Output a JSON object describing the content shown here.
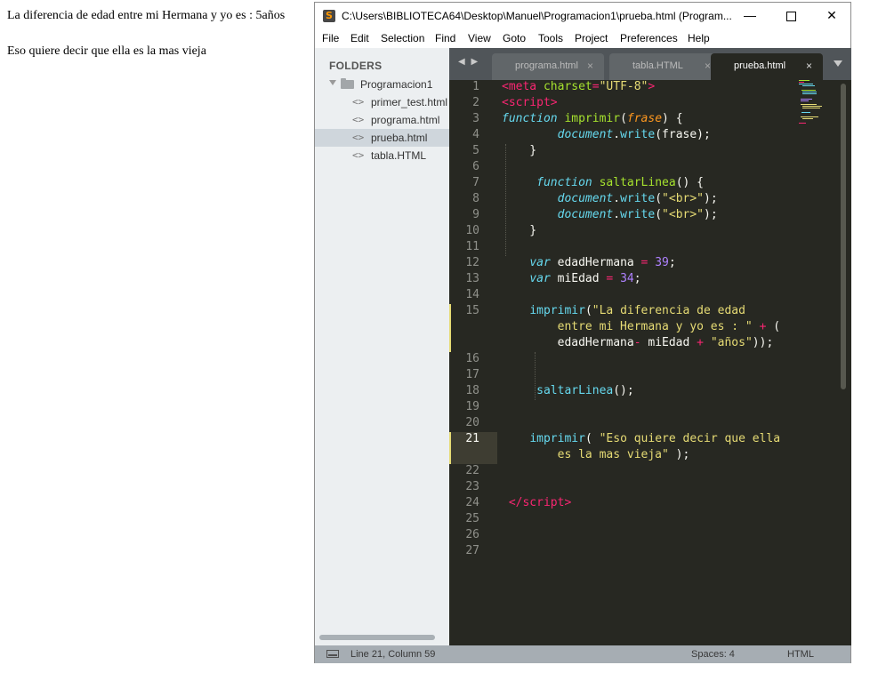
{
  "browser": {
    "line1": "La diferencia de edad entre mi Hermana y yo es : 5años",
    "line2": "Eso quiere decir que ella es la mas vieja"
  },
  "window": {
    "title": "C:\\Users\\BIBLIOTECA64\\Desktop\\Manuel\\Programacion1\\prueba.html (Program...",
    "app_icon": "S",
    "icons": [
      "sublime-text-icon",
      "minimize-icon",
      "maximize-icon",
      "close-icon"
    ]
  },
  "menu": [
    "File",
    "Edit",
    "Selection",
    "Find",
    "View",
    "Goto",
    "Tools",
    "Project",
    "Preferences",
    "Help"
  ],
  "sidebar": {
    "title": "FOLDERS",
    "folder": "Programacion1",
    "files": [
      "primer_test.html",
      "programa.html",
      "prueba.html",
      "tabla.HTML"
    ],
    "active_file": "prueba.html",
    "file_icon": "<>"
  },
  "tabs": {
    "nav": "◀ ▶",
    "items": [
      {
        "label": "programa.html",
        "close": "×"
      },
      {
        "label": "tabla.HTML",
        "close": "×"
      },
      {
        "label": "prueba.html",
        "close": "×"
      }
    ],
    "active": "prueba.html"
  },
  "editor": {
    "line_numbers": [
      "1",
      "2",
      "3",
      "4",
      "5",
      "6",
      "7",
      "8",
      "9",
      "10",
      "11",
      "12",
      "13",
      "14",
      "15",
      "16",
      "17",
      "18",
      "19",
      "20",
      "21",
      "22",
      "23",
      "24",
      "25",
      "26",
      "27"
    ],
    "current_line": "21",
    "theme_colors": {
      "background": "#272822",
      "tag": "#f92672",
      "string": "#e6db74",
      "keyword": "#66d9ef",
      "function": "#a6e22e",
      "number": "#ae81ff",
      "parameter": "#fd971f"
    }
  },
  "status": {
    "position": "Line 21, Column 59",
    "spaces": "Spaces: 4",
    "syntax": "HTML"
  }
}
